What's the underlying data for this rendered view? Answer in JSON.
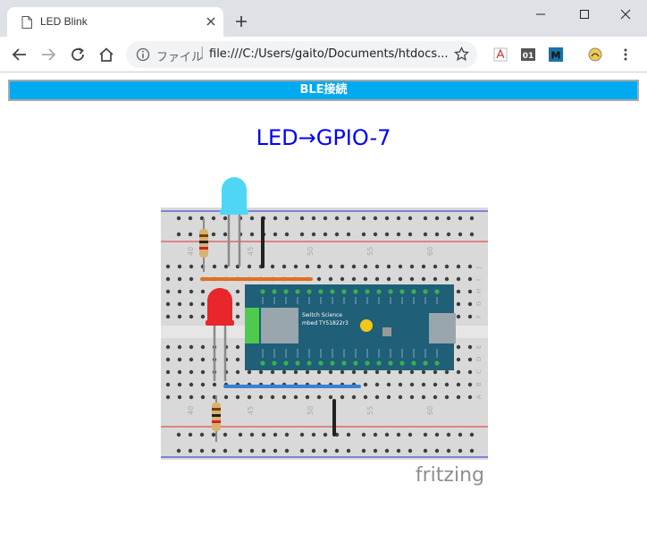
{
  "browser": {
    "tab_title": "LED Blink",
    "url_scheme_label": "ファイル",
    "url": "file:///C:/Users/gaito/Documents/htdocs..."
  },
  "page": {
    "ble_button_label": "BLE接続",
    "heading": "LED→GPIO-7"
  },
  "figure": {
    "watermark": "fritzing",
    "board_label_line1": "Switch Science",
    "board_label_line2": "mbed TY51822r3",
    "column_numbers": [
      "40",
      "45",
      "50",
      "55",
      "60"
    ],
    "row_letters_top": [
      "J",
      "I",
      "H",
      "G",
      "F"
    ],
    "row_letters_bottom": [
      "E",
      "D",
      "C",
      "B",
      "A"
    ],
    "led_colors": {
      "top": "#4fd6f5",
      "bottom": "#e8262b"
    }
  }
}
